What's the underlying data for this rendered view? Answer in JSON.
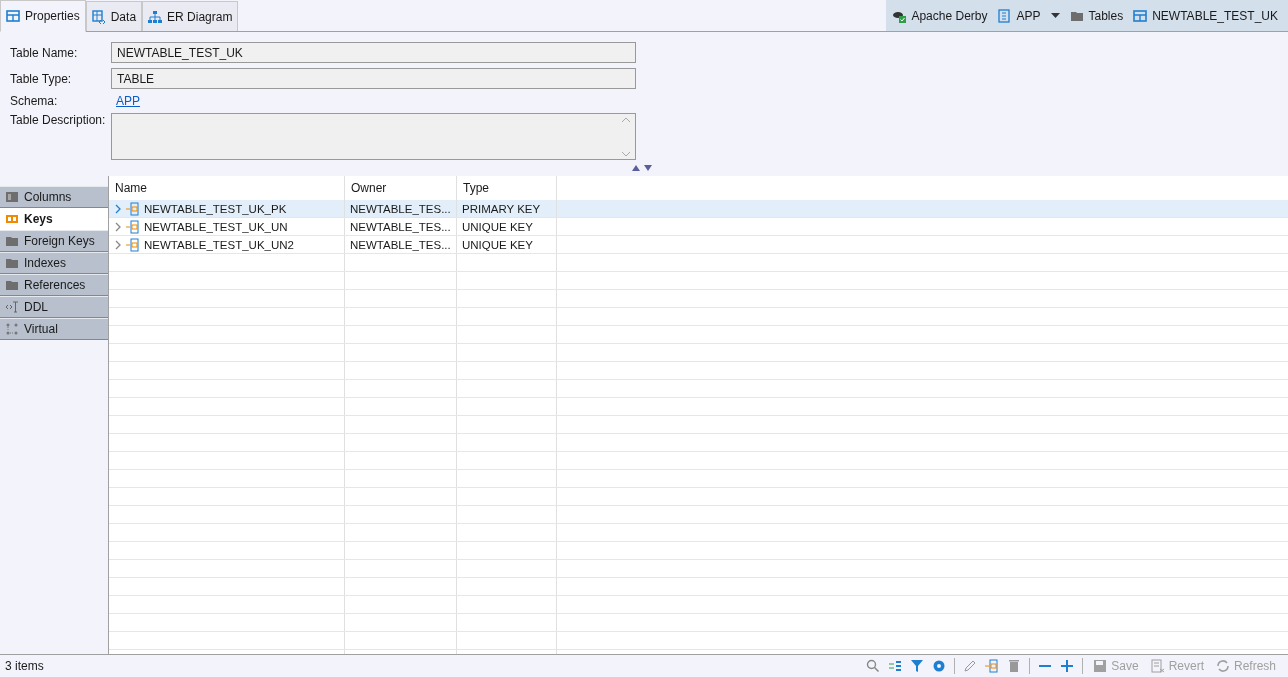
{
  "editor_tabs": [
    {
      "label": "Properties",
      "kind": "table",
      "selected": true
    },
    {
      "label": "Data",
      "kind": "data",
      "selected": false
    },
    {
      "label": "ER Diagram",
      "kind": "diagram",
      "selected": false
    }
  ],
  "breadcrumb": [
    {
      "label": "Apache Derby",
      "kind": "db"
    },
    {
      "label": "APP",
      "kind": "schema"
    },
    {
      "label": "Tables",
      "kind": "folder",
      "dropdown": true
    },
    {
      "label": "NEWTABLE_TEST_UK",
      "kind": "table"
    }
  ],
  "form": {
    "table_name": {
      "label": "Table Name:",
      "value": "NEWTABLE_TEST_UK"
    },
    "table_type": {
      "label": "Table Type:",
      "value": "TABLE"
    },
    "schema": {
      "label": "Schema:",
      "value": "APP"
    },
    "table_description": {
      "label": "Table Description:"
    }
  },
  "side_tabs": [
    {
      "label": "Columns",
      "kind": "columns",
      "selected": false
    },
    {
      "label": "Keys",
      "kind": "keys",
      "selected": true
    },
    {
      "label": "Foreign Keys",
      "kind": "folder",
      "selected": false
    },
    {
      "label": "Indexes",
      "kind": "folder",
      "selected": false
    },
    {
      "label": "References",
      "kind": "folder",
      "selected": false
    },
    {
      "label": "DDL",
      "kind": "ddl",
      "selected": false
    },
    {
      "label": "Virtual",
      "kind": "virtual",
      "selected": false
    }
  ],
  "table": {
    "columns": [
      "Name",
      "Owner",
      "Type"
    ],
    "rows": [
      {
        "name": "NEWTABLE_TEST_UK_PK",
        "owner": "NEWTABLE_TES...",
        "type": "PRIMARY KEY",
        "selected": true
      },
      {
        "name": "NEWTABLE_TEST_UK_UN",
        "owner": "NEWTABLE_TES...",
        "type": "UNIQUE KEY",
        "selected": false
      },
      {
        "name": "NEWTABLE_TEST_UK_UN2",
        "owner": "NEWTABLE_TES...",
        "type": "UNIQUE KEY",
        "selected": false
      }
    ]
  },
  "status_bar": {
    "count": "3 items",
    "tools": [
      {
        "kind": "search"
      },
      {
        "kind": "columns"
      },
      {
        "kind": "filter"
      },
      {
        "kind": "gear"
      },
      {
        "kind": "sep"
      },
      {
        "kind": "pencil"
      },
      {
        "kind": "addkey"
      },
      {
        "kind": "trash"
      },
      {
        "kind": "sep"
      },
      {
        "kind": "minus"
      },
      {
        "kind": "plus"
      },
      {
        "kind": "sep"
      }
    ],
    "actions": [
      {
        "label": "Save",
        "kind": "save",
        "disabled": true
      },
      {
        "label": "Revert",
        "kind": "revert",
        "disabled": true
      },
      {
        "label": "Refresh",
        "kind": "refresh",
        "disabled": true
      }
    ]
  }
}
